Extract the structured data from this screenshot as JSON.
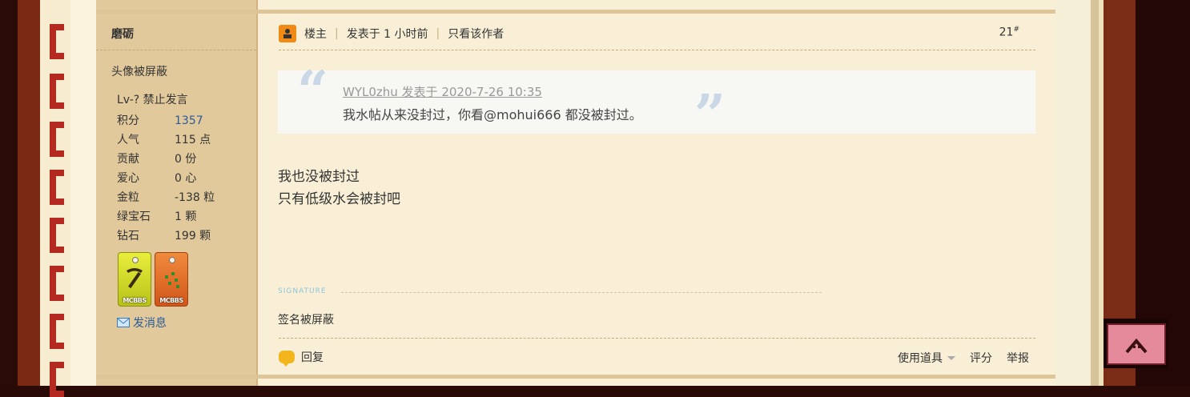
{
  "author": {
    "name": "磨砺",
    "avatar_text": "头像被屏蔽",
    "level": "Lv-? 禁止发言",
    "stats": [
      {
        "label": "积分",
        "value": "1357",
        "link": true
      },
      {
        "label": "人气",
        "value": "115 点"
      },
      {
        "label": "贡献",
        "value": "0 份"
      },
      {
        "label": "爱心",
        "value": "0 心"
      },
      {
        "label": "金粒",
        "value": "-138 粒"
      },
      {
        "label": "绿宝石",
        "value": "1 颗"
      },
      {
        "label": "钻石",
        "value": "199 颗"
      }
    ],
    "medals": [
      {
        "tag": "MCBBS",
        "color": "#e0e63a",
        "icon": "pickaxe-icon"
      },
      {
        "tag": "MCBBS",
        "color": "#e56d28",
        "icon": "seeds-icon"
      }
    ],
    "message_label": "发消息"
  },
  "post": {
    "header": {
      "op_label": "楼主",
      "posted": "发表于 1 小时前",
      "only_author": "只看该作者",
      "floor": "21",
      "floor_mark": "#"
    },
    "quote": {
      "head": "WYL0zhu 发表于 2020-7-26 10:35",
      "text": "我水帖从来没封过，你看@mohui666 都没被封过。"
    },
    "body": [
      "我也没被封过",
      "只有低级水会被封吧"
    ],
    "signature_label": "SIGNATURE",
    "signature": "签名被屏蔽"
  },
  "footer": {
    "reply": "回复",
    "tools": "使用道具",
    "rate": "评分",
    "report": "举报"
  },
  "colors": {
    "author_bg": "#e1c99c",
    "post_bg": "#f9efd6",
    "link": "#2a5a9a",
    "accent_orange": "#f08a14"
  }
}
